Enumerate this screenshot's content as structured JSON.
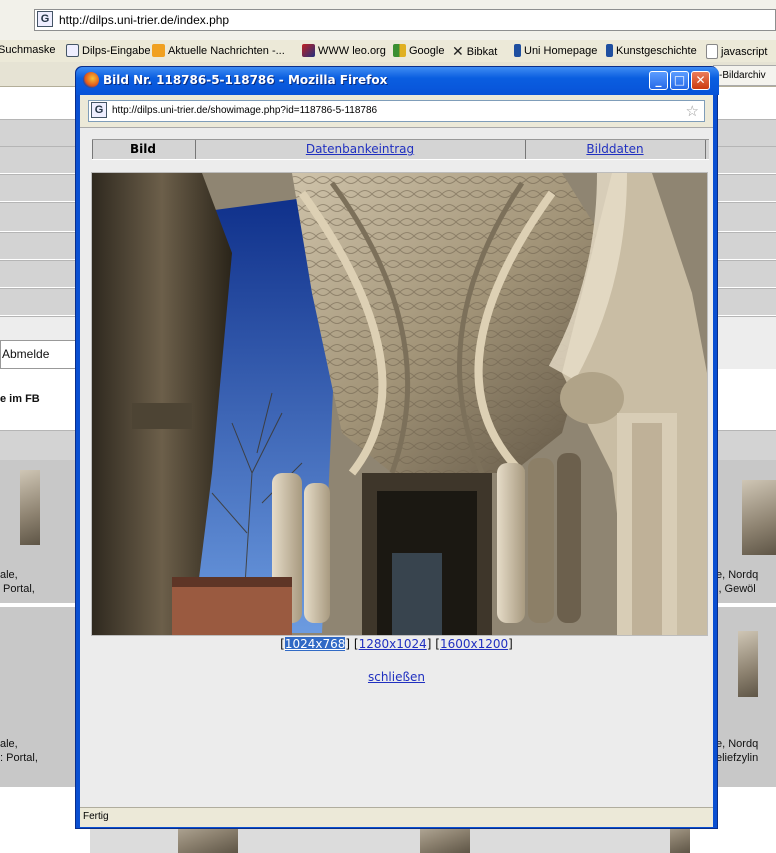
{
  "background_browser": {
    "url": "http://dilps.uni-trier.de/index.php",
    "bookmarks": [
      "Suchmaske",
      "Dilps-Eingabe",
      "Aktuelle Nachrichten -...",
      "WWW leo.org",
      "Google",
      "Bibkat",
      "Uni Homepage",
      "Kunstgeschichte",
      "javascript"
    ],
    "tab_right_label": "s-Bildarchiv",
    "partial_labels": {
      "logout": "Abmelde",
      "fb_heading": "e im FB",
      "left_caption_1": "ale,\n Portal,",
      "left_caption_2": "ale,\n: Portal,",
      "right_caption_1": "e, Nordq\nl, Gewöl",
      "right_caption_2": "e, Nordq\neliefzylin"
    }
  },
  "popup": {
    "title": "Bild Nr. 118786-5-118786 - Mozilla Firefox",
    "url": "http://dilps.uni-trier.de/showimage.php?id=118786-5-118786",
    "tabs": [
      "Bild",
      "Datenbankeintrag",
      "Bilddaten"
    ],
    "active_tab": "Bild",
    "resolutions": [
      "1024x768",
      "1280x1024",
      "1600x1200"
    ],
    "selected_resolution": "1024x768",
    "close_link": "schließen",
    "status": "Fertig"
  },
  "colors": {
    "title_bar": "#0a5ee0",
    "link": "#2030c0",
    "selection": "#316ac5",
    "close_button": "#cc3a10"
  }
}
